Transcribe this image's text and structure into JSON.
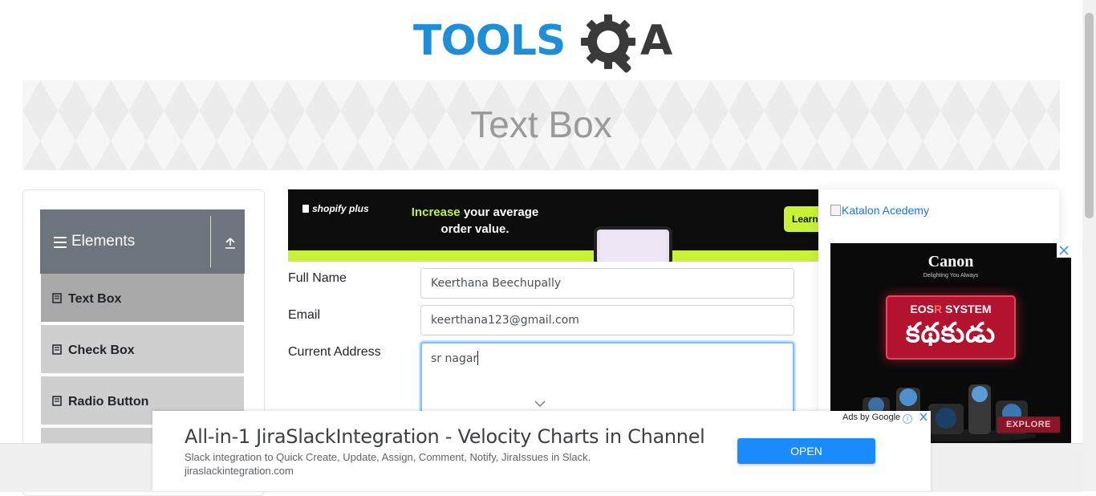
{
  "header": {
    "logo_text_main": "TOOLS",
    "logo_text_a": "A",
    "logo_icon": "gear-magnifier-icon"
  },
  "banner": {
    "title": "Text Box"
  },
  "sidebar": {
    "group": {
      "title": "Elements",
      "menu_icon": "hamburger-icon",
      "collapse_icon": "upload-arrow-icon"
    },
    "items": [
      {
        "label": "Text Box",
        "icon": "doc-icon",
        "active": true
      },
      {
        "label": "Check Box",
        "icon": "doc-icon",
        "active": false
      },
      {
        "label": "Radio Button",
        "icon": "doc-icon",
        "active": false
      }
    ]
  },
  "top_ad": {
    "brand": "shopify plus",
    "headline_highlight": "Increase",
    "headline_rest": " your average order value.",
    "cta": "Learn"
  },
  "form": {
    "full_name": {
      "label": "Full Name",
      "value": "Keerthana Beechupally"
    },
    "email": {
      "label": "Email",
      "value": "keerthana123@gmail.com"
    },
    "current_address": {
      "label": "Current Address",
      "value": "sr nagar"
    }
  },
  "right_ads": {
    "katalon_alt": "Katalon Acedemy",
    "canon": {
      "brand": "Canon",
      "tagline": "Delighting You Always",
      "system_prefix": "EOS",
      "system_r": "R",
      "system_suffix": " SYSTEM",
      "telugu": "కథకుడు",
      "cta": "EXPLORE"
    }
  },
  "bottom_ad": {
    "ads_by": "Ads by Google",
    "headline": "All-in-1 JiraSlackIntegration - Velocity Charts in Channel",
    "description": "Slack integration to Quick Create, Update, Assign, Comment, Notify, JiraIssues in Slack.",
    "url": "jiraslackintegration.com",
    "cta": "OPEN"
  },
  "colors": {
    "brand_blue": "#1f8ed6",
    "sidebar_header": "#6c757d",
    "menu_active": "#a9a9a9",
    "menu_item": "#cfcfcf",
    "shopify_green": "#c7f235",
    "canon_red": "#b3132e",
    "open_button": "#1a8cff"
  }
}
